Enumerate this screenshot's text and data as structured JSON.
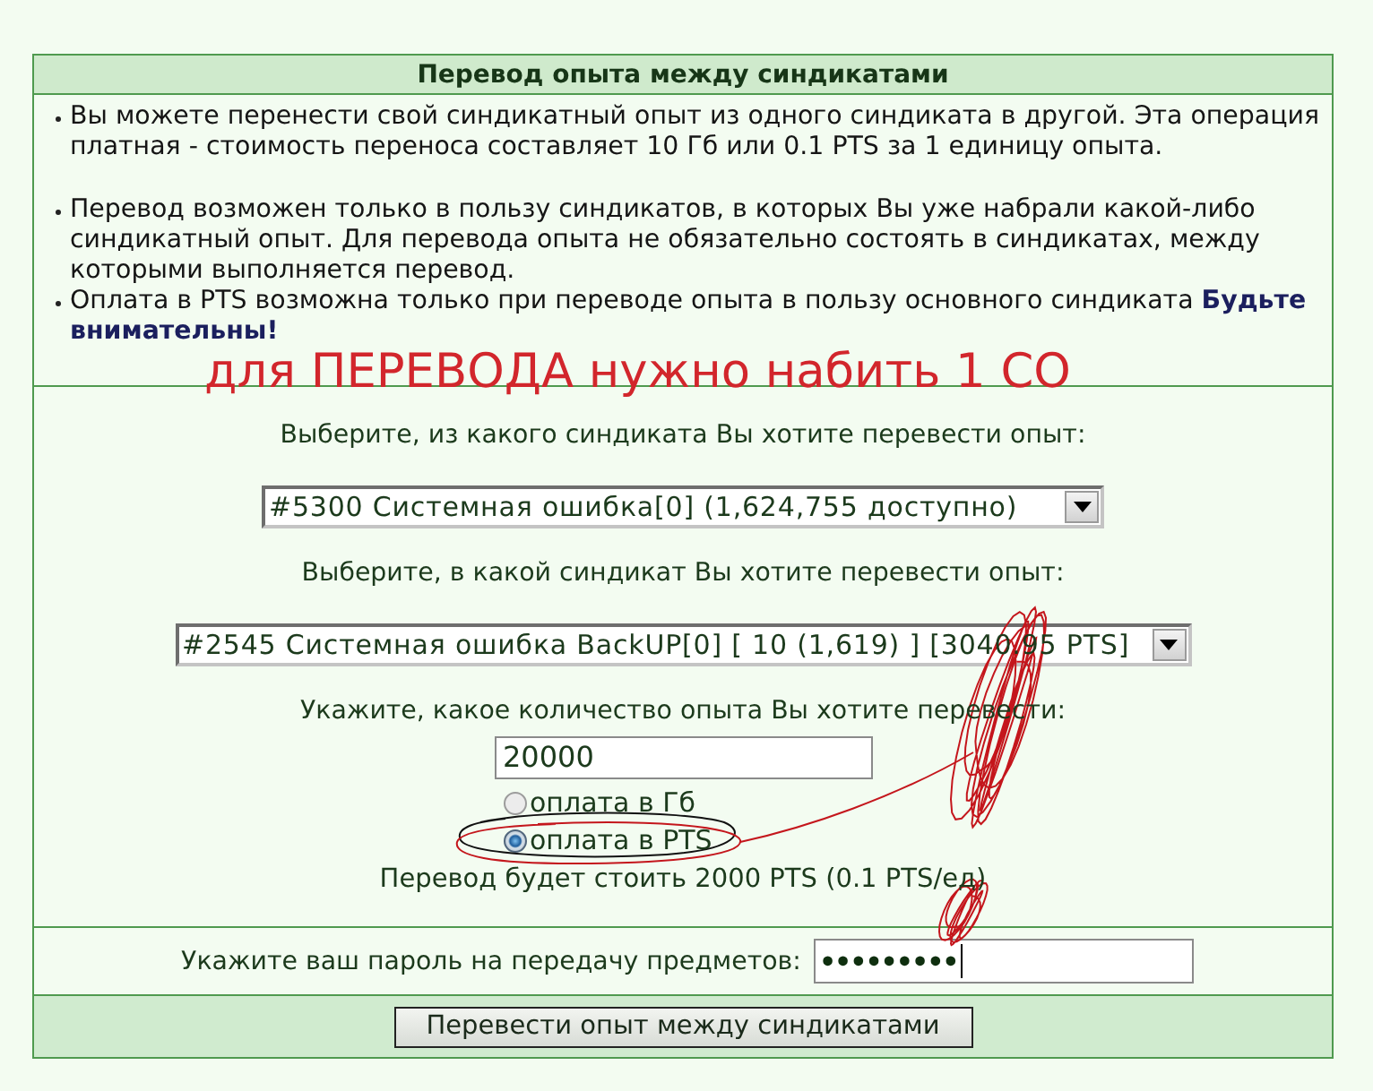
{
  "panel": {
    "title": "Перевод опыта между синдикатами"
  },
  "info": {
    "items": [
      "Вы можете перенести свой синдикатный опыт из одного синдиката в другой. Эта операция платная - стоимость переноса составляет 10 Гб или 0.1 PTS за 1 единицу опыта.",
      "Перевод возможен только в пользу синдикатов, в которых Вы уже набрали какой-либо синдикатный опыт. Для перевода опыта не обязательно состоять в синдикатах, между которыми выполняется перевод.",
      "Оплата в PTS возможна только при переводе опыта в пользу основного синдиката **Будьте внимательны!**"
    ]
  },
  "annotation": {
    "text": "для ПЕРЕВОДА нужно набить 1 СО"
  },
  "form": {
    "source_label": "Выберите, из какого синдиката Вы хотите перевести опыт:",
    "source_select": {
      "value": "#5300 Системная ошибка[0] (1,624,755 доступно)"
    },
    "target_label": "Выберите, в какой синдикат Вы хотите перевести опыт:",
    "target_select": {
      "value": "#2545 Системная ошибка BackUP[0] [ 10 (1,619) ] [3040.95 PTS]"
    },
    "amount_label": "Укажите, какое количество опыта Вы хотите перевести:",
    "amount_field": {
      "value": "20000"
    },
    "payment_options": [
      {
        "label": "оплата в Гб",
        "selected": false
      },
      {
        "label": "оплата в PTS",
        "selected": true
      }
    ],
    "cost_text": "Перевод будет стоить 2000 PTS (0.1 PTS/ед)"
  },
  "password": {
    "label": "Укажите ваш пароль на передачу предметов:",
    "value": "•••••••••",
    "focused": true
  },
  "submit_button": {
    "label": "Перевести опыт между синдикатами"
  }
}
